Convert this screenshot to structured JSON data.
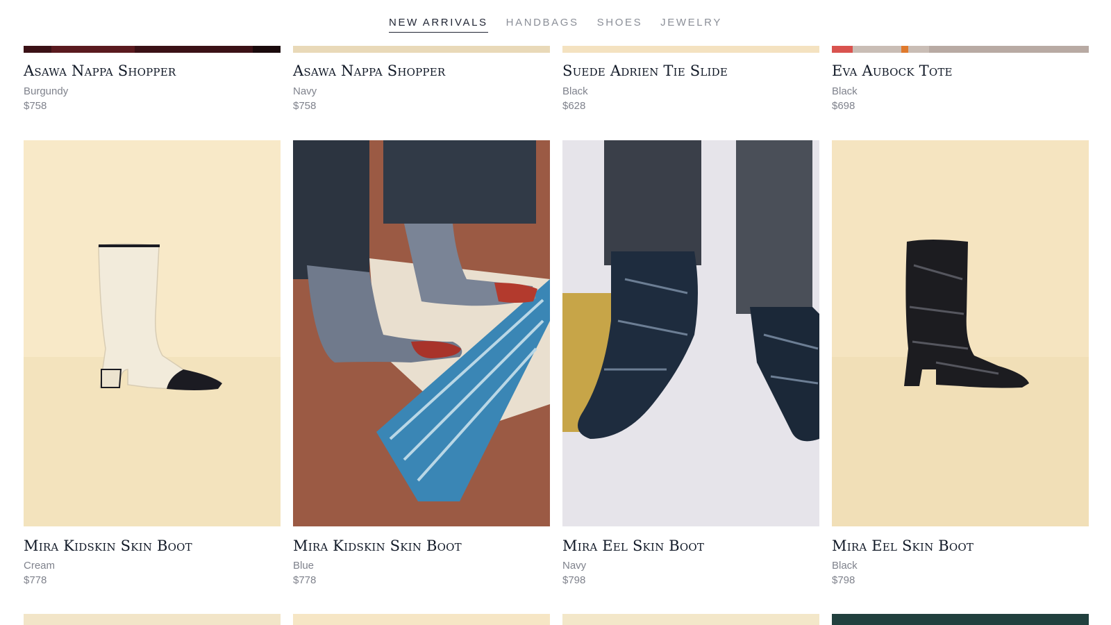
{
  "nav": {
    "items": [
      {
        "label": "NEW ARRIVALS",
        "active": true
      },
      {
        "label": "HANDBAGS",
        "active": false
      },
      {
        "label": "SHOES",
        "active": false
      },
      {
        "label": "JEWELRY",
        "active": false
      }
    ]
  },
  "products": {
    "row1": [
      {
        "name": "Asawa Nappa Shopper",
        "color": "Burgundy",
        "price": "$758"
      },
      {
        "name": "Asawa Nappa Shopper",
        "color": "Navy",
        "price": "$758"
      },
      {
        "name": "Suede Adrien Tie Slide",
        "color": "Black",
        "price": "$628"
      },
      {
        "name": "Eva Aubock Tote",
        "color": "Black",
        "price": "$698"
      }
    ],
    "row2": [
      {
        "name": "Mira Kidskin Skin Boot",
        "color": "Cream",
        "price": "$778",
        "image_icon": "cream-boot-product-image"
      },
      {
        "name": "Mira Kidskin Skin Boot",
        "color": "Blue",
        "price": "$778",
        "image_icon": "blue-boot-lifestyle-image"
      },
      {
        "name": "Mira Eel Skin Boot",
        "color": "Navy",
        "price": "$798",
        "image_icon": "navy-boot-lifestyle-image"
      },
      {
        "name": "Mira Eel Skin Boot",
        "color": "Black",
        "price": "$798",
        "image_icon": "black-boot-product-image"
      }
    ]
  },
  "colors": {
    "nav_active": "#1f2433",
    "nav_inactive": "#8b8f98",
    "name_text": "#101826",
    "meta_text": "#7f828c",
    "beige_background": "#f6e7c6"
  }
}
